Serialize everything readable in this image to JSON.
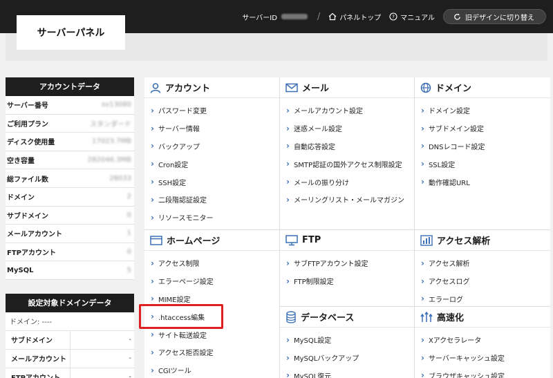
{
  "header": {
    "logo": "サーバーパネル",
    "server_id_label": "サーバーID",
    "panel_top": "パネルトップ",
    "manual": "マニュアル",
    "old_design": "旧デザインに切り替え"
  },
  "account_data": {
    "title": "アカウントデータ",
    "rows": [
      {
        "k": "サーバー番号",
        "v": "sv13080"
      },
      {
        "k": "ご利用プラン",
        "v": "スタンダード"
      },
      {
        "k": "ディスク使用量",
        "v": "17023.7MB"
      },
      {
        "k": "空き容量",
        "v": "282046.3MB"
      },
      {
        "k": "総ファイル数",
        "v": "28033"
      },
      {
        "k": "ドメイン",
        "v": "2"
      },
      {
        "k": "サブドメイン",
        "v": "0"
      },
      {
        "k": "メールアカウント",
        "v": "1"
      },
      {
        "k": "FTPアカウント",
        "v": "0"
      },
      {
        "k": "MySQL",
        "v": "5"
      }
    ]
  },
  "domain_data": {
    "title": "設定対象ドメインデータ",
    "domain_line": "ドメイン: ----",
    "rows": [
      {
        "k": "サブドメイン",
        "v": "-"
      },
      {
        "k": "メールアカウント",
        "v": "-"
      },
      {
        "k": "FTPアカウント",
        "v": "-"
      }
    ]
  },
  "sections": {
    "account": {
      "title": "アカウント",
      "items": [
        "パスワード変更",
        "サーバー情報",
        "バックアップ",
        "Cron設定",
        "SSH設定",
        "二段階認証設定",
        "リソースモニター"
      ]
    },
    "mail": {
      "title": "メール",
      "items": [
        "メールアカウント設定",
        "迷惑メール設定",
        "自動応答設定",
        "SMTP認証の国外アクセス制限設定",
        "メールの振り分け",
        "メーリングリスト・メールマガジン"
      ]
    },
    "domain": {
      "title": "ドメイン",
      "items": [
        "ドメイン設定",
        "サブドメイン設定",
        "DNSレコード設定",
        "SSL設定",
        "動作確認URL"
      ]
    },
    "homepage": {
      "title": "ホームページ",
      "items": [
        "アクセス制限",
        "エラーページ設定",
        "MIME設定",
        ".htaccess編集",
        "サイト転送設定",
        "アクセス拒否設定",
        "CGIツール"
      ]
    },
    "ftp": {
      "title": "FTP",
      "items": [
        "サブFTPアカウント設定",
        "FTP制限設定"
      ]
    },
    "analytics": {
      "title": "アクセス解析",
      "items": [
        "アクセス解析",
        "アクセスログ",
        "エラーログ"
      ]
    },
    "database": {
      "title": "データベース",
      "items": [
        "MySQL設定",
        "MySQLバックアップ",
        "MySQL復元"
      ]
    },
    "speed": {
      "title": "高速化",
      "items": [
        "Xアクセラレータ",
        "サーバーキャッシュ設定",
        "ブラウザキャッシュ設定"
      ]
    }
  },
  "colors": {
    "accent_blue": "#3a6fb5",
    "highlight_red": "#e02020",
    "dark": "#1e1e1e"
  }
}
